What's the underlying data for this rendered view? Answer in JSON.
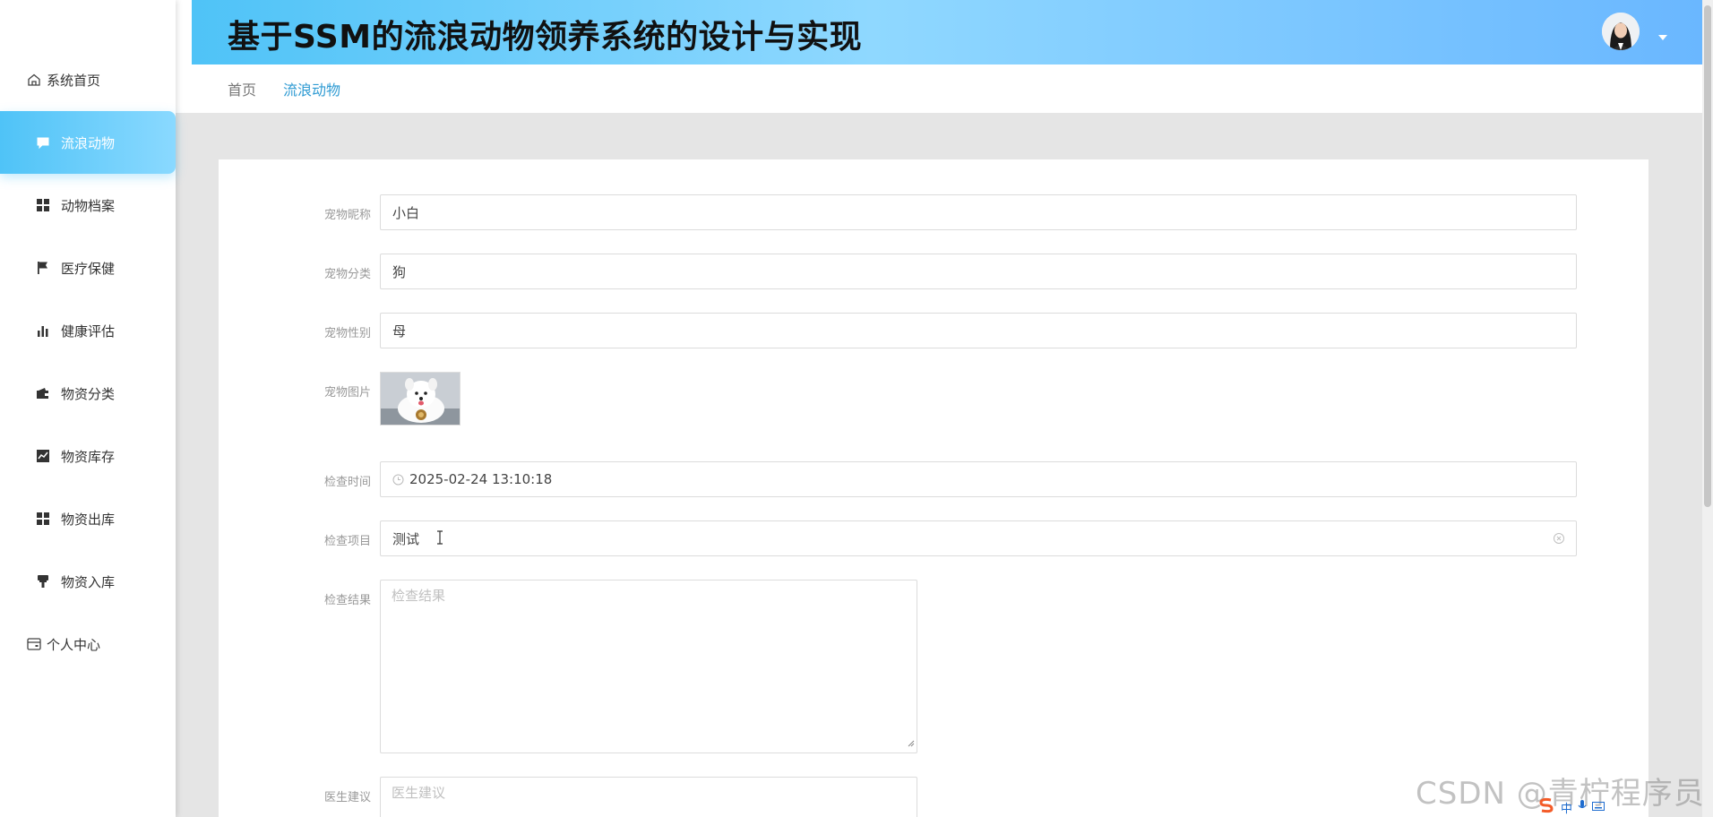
{
  "app": {
    "title": "基于SSM的流浪动物领养系统的设计与实现"
  },
  "sidebar": {
    "items": [
      {
        "label": "系统首页",
        "icon": "home-icon"
      },
      {
        "label": "流浪动物",
        "icon": "chat-icon",
        "active": true
      },
      {
        "label": "动物档案",
        "icon": "grid-icon"
      },
      {
        "label": "医疗保健",
        "icon": "flag-icon"
      },
      {
        "label": "健康评估",
        "icon": "bar-chart-icon"
      },
      {
        "label": "物资分类",
        "icon": "wallet-icon"
      },
      {
        "label": "物资库存",
        "icon": "trend-chart-icon"
      },
      {
        "label": "物资出库",
        "icon": "grid-icon"
      },
      {
        "label": "物资入库",
        "icon": "stamp-icon"
      },
      {
        "label": "个人中心",
        "icon": "card-icon"
      }
    ]
  },
  "breadcrumb": {
    "home": "首页",
    "current": "流浪动物"
  },
  "form": {
    "pet_name": {
      "label": "宠物昵称",
      "value": "小白"
    },
    "pet_category": {
      "label": "宠物分类",
      "value": "狗"
    },
    "pet_gender": {
      "label": "宠物性别",
      "value": "母"
    },
    "pet_image": {
      "label": "宠物图片"
    },
    "check_time": {
      "label": "检查时间",
      "value": "2025-02-24 13:10:18"
    },
    "check_item": {
      "label": "检查项目",
      "value": "测试"
    },
    "check_result": {
      "label": "检查结果",
      "placeholder": "检查结果"
    },
    "doctor_advice": {
      "label": "医生建议",
      "placeholder": "医生建议"
    }
  },
  "watermark": "CSDN @青柠程序员",
  "tray": {
    "ime": "中"
  },
  "colors": {
    "accent": "#4fc3f7",
    "link": "#2f9bd3",
    "content_bg": "#e5e5e5"
  }
}
